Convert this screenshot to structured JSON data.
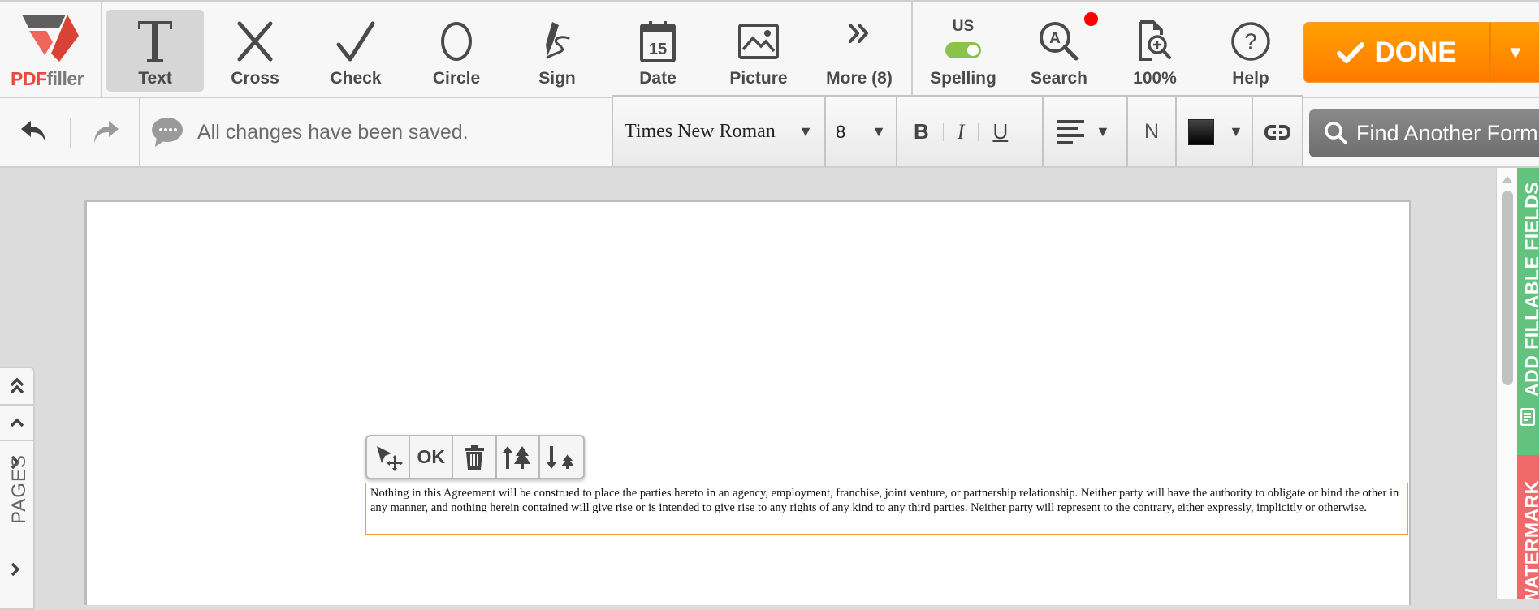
{
  "app": {
    "logo": {
      "pdf": "PDF",
      "filler": "filler"
    }
  },
  "toolbar": {
    "tools": [
      {
        "id": "text",
        "label": "Text",
        "icon": "text-icon",
        "active": true
      },
      {
        "id": "cross",
        "label": "Cross",
        "icon": "cross-icon"
      },
      {
        "id": "check",
        "label": "Check",
        "icon": "check-icon"
      },
      {
        "id": "circle",
        "label": "Circle",
        "icon": "circle-icon"
      },
      {
        "id": "sign",
        "label": "Sign",
        "icon": "signature-pen-icon"
      },
      {
        "id": "date",
        "label": "Date",
        "icon": "calendar-icon",
        "calendar_day": "15"
      },
      {
        "id": "picture",
        "label": "Picture",
        "icon": "image-icon"
      },
      {
        "id": "more",
        "label": "More (8)",
        "icon": "double-chevron-right-icon"
      }
    ],
    "spelling": {
      "label": "Spelling",
      "locale": "US",
      "enabled": true
    },
    "search": {
      "label": "Search",
      "notification": true
    },
    "zoom": {
      "label": "100%"
    },
    "help": {
      "label": "Help"
    },
    "done": {
      "label": "DONE"
    }
  },
  "format_bar": {
    "undo": "undo",
    "redo": "redo",
    "status": "All changes have been saved.",
    "font_family": "Times New Roman",
    "font_size": "8",
    "bold": "B",
    "italic": "I",
    "underline": "U",
    "align": "left",
    "text_style": "N",
    "color": "#111111",
    "find_form": "Find Another Form"
  },
  "float_toolbar": {
    "ok_label": "OK"
  },
  "document": {
    "text_box": "Nothing in this Agreement will be construed to place the parties hereto in an agency, employment, franchise, joint venture, or partnership relationship. Neither party will have the authority to obligate or bind the other in any manner, and nothing herein contained will give rise or is intended to give rise to any rights of any kind to any third parties. Neither party will represent to the contrary, either expressly, implicitly or otherwise."
  },
  "pages_panel": {
    "label": "PAGES"
  },
  "side_tabs": {
    "fillable": "ADD FILLABLE FIELDS",
    "watermark": "WATERMARK"
  },
  "colors": {
    "accent_orange": "#ff8c00",
    "fillable_green": "#62c37f",
    "watermark_red": "#ef6b6b",
    "toggle_green": "#8bc34a",
    "logo_red": "#e8493f"
  }
}
